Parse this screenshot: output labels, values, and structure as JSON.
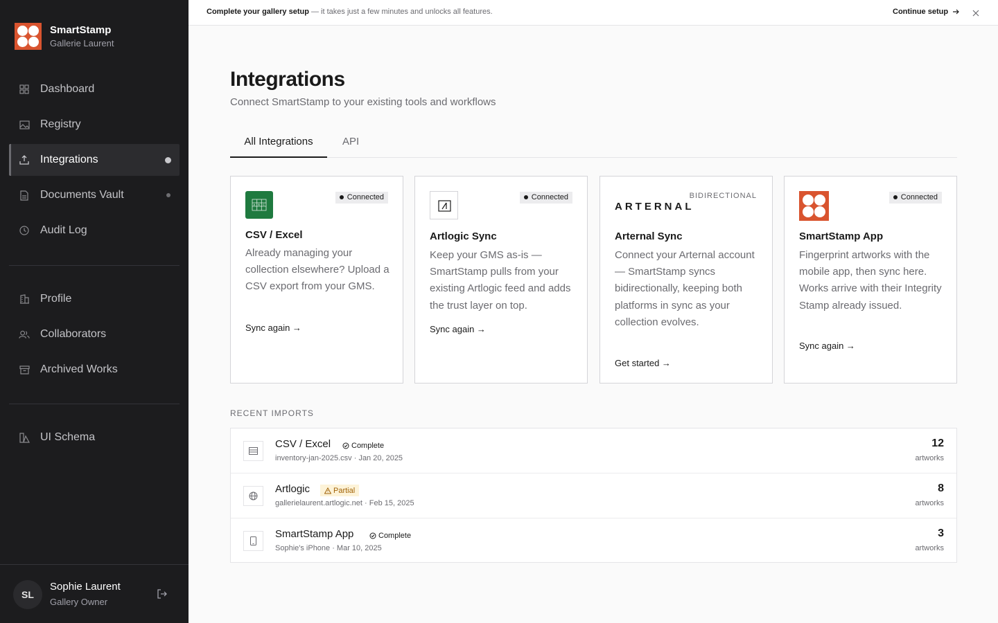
{
  "sidebar": {
    "brand_name": "SmartStamp",
    "brand_sub": "Gallerie Laurent",
    "nav_primary": [
      {
        "label": "Dashboard",
        "icon": "grid-icon"
      },
      {
        "label": "Registry",
        "icon": "image-icon"
      },
      {
        "label": "Integrations",
        "icon": "upload-icon",
        "active": true
      },
      {
        "label": "Documents Vault",
        "icon": "document-icon"
      },
      {
        "label": "Audit Log",
        "icon": "clock-icon"
      }
    ],
    "nav_secondary": [
      {
        "label": "Profile",
        "icon": "building-icon"
      },
      {
        "label": "Collaborators",
        "icon": "users-icon"
      },
      {
        "label": "Archived Works",
        "icon": "archive-icon"
      }
    ],
    "nav_tertiary": [
      {
        "label": "UI Schema",
        "icon": "shapes-icon"
      }
    ],
    "user": {
      "initials": "SL",
      "name": "Sophie Laurent",
      "role": "Gallery Owner"
    }
  },
  "banner": {
    "strong": "Complete your gallery setup",
    "text": " — it takes just a few minutes and unlocks all features.",
    "cta": "Continue setup"
  },
  "page": {
    "title": "Integrations",
    "subtitle": "Connect SmartStamp to your existing tools and workflows",
    "tabs": [
      "All Integrations",
      "API"
    ]
  },
  "cards": [
    {
      "title": "CSV / Excel",
      "badge": "Connected",
      "desc": "Already managing your collection elsewhere? Upload a CSV export from your GMS.",
      "link": "Sync again →"
    },
    {
      "title": "Artlogic Sync",
      "badge": "Connected",
      "desc": "Keep your GMS as-is — SmartStamp pulls from your existing Artlogic feed and adds the trust layer on top.",
      "link": "Sync again →"
    },
    {
      "title": "Arternal Sync",
      "tag": "BIDIRECTIONAL",
      "logo_text": "ARTERNAL",
      "desc": "Connect your Arternal account — SmartStamp syncs bidirectionally, keeping both platforms in sync as your collection evolves.",
      "link": "Get started →"
    },
    {
      "title": "SmartStamp App",
      "badge": "Connected",
      "desc": "Fingerprint artworks with the mobile app, then sync here. Works arrive with their Integrity Stamp already issued.",
      "link": "Sync again →"
    }
  ],
  "recent": {
    "label": "RECENT IMPORTS",
    "rows": [
      {
        "name": "CSV / Excel",
        "status": "Complete",
        "meta": "inventory-jan-2025.csv · Jan 20, 2025",
        "count": "12",
        "unit": "artworks"
      },
      {
        "name": "Artlogic",
        "status": "Partial",
        "meta": "gallerielaurent.artlogic.net · Feb 15, 2025",
        "count": "8",
        "unit": "artworks"
      },
      {
        "name": "SmartStamp App",
        "status": "Complete",
        "meta": "Sophie's iPhone · Mar 10, 2025",
        "count": "3",
        "unit": "artworks"
      }
    ]
  },
  "colors": {
    "brand": "#d9542f",
    "sidebar_bg": "#1c1c1e",
    "csv_green": "#1f7a3f",
    "partial_bg": "#fdf3d8",
    "partial_text": "#a16207"
  }
}
